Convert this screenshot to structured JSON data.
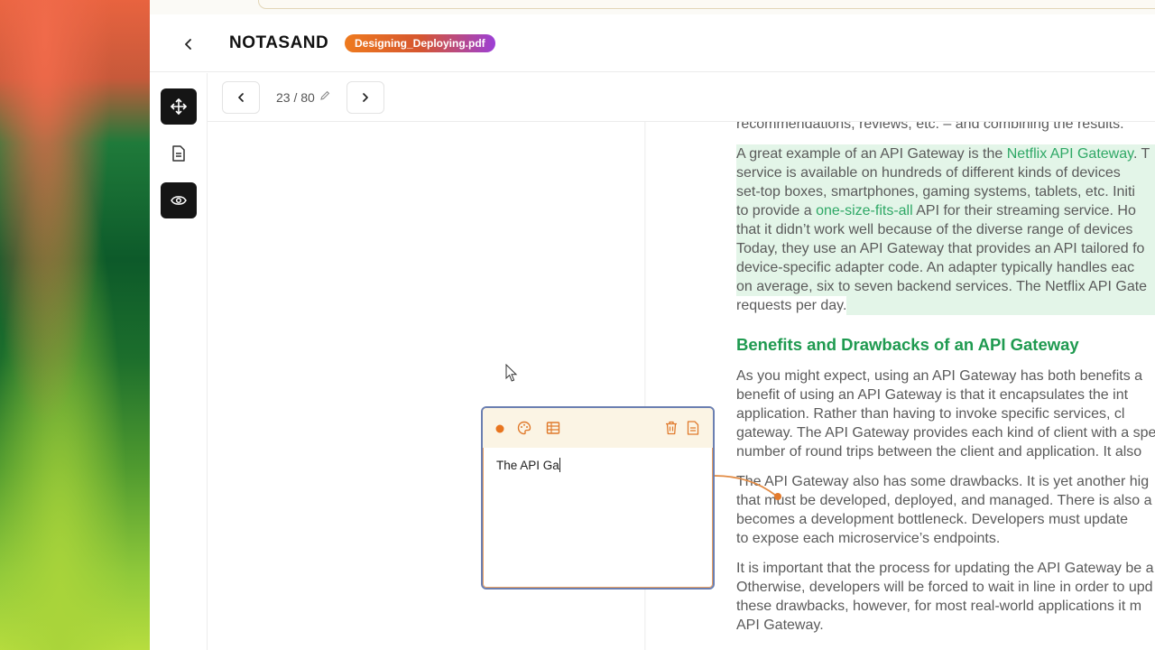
{
  "app": {
    "brand": "NOTASAND",
    "file_name": "Designing_Deploying.pdf"
  },
  "pager": {
    "page_label": "23 / 80"
  },
  "tools": [
    {
      "name": "move-tool",
      "icon": "move-icon",
      "active": true
    },
    {
      "name": "document-tool",
      "icon": "document-icon",
      "active": false
    },
    {
      "name": "view-tool",
      "icon": "eye-icon",
      "active": true
    }
  ],
  "note": {
    "text": "The API Ga",
    "icons": [
      "status-dot-icon",
      "palette-icon",
      "table-icon",
      "trash-icon",
      "note-document-icon"
    ]
  },
  "document": {
    "top_line": "recommendations, reviews, etc. – and combining the results.",
    "para1": {
      "l1a": "A great example of an API Gateway is the ",
      "l1_link": "Netflix API Gateway",
      "l1b": ". T",
      "l2": "service is available on hundreds of different kinds of devices",
      "l3": "set-top boxes, smartphones, gaming systems, tablets, etc. Initi",
      "l4a": "to provide a ",
      "l4_link": "one-size-fits-all",
      "l4b": " API for their streaming service. Ho",
      "l5": "that it didn’t work well because of the diverse range of devices",
      "l6": "Today, they use an API Gateway that provides an API tailored fo",
      "l7": "device-specific adapter code. An adapter typically handles eac",
      "l8": "on average, six to seven backend services. The Netflix API Gate",
      "l9": "requests per day."
    },
    "heading": "Benefits and Drawbacks of an API Gateway",
    "para2": [
      "As you might expect, using an API Gateway has both benefits a",
      "benefit of using an API Gateway is that it encapsulates the int",
      "application. Rather than having to invoke specific services, cl",
      "gateway. The API Gateway provides each kind of client with a spe",
      "number of round trips between the client and application. It also"
    ],
    "para3": [
      "The API Gateway also has some drawbacks. It is yet another hig",
      "that must be developed, deployed, and managed. There is also a",
      "becomes a development bottleneck. Developers must update",
      "to expose each microservice’s endpoints."
    ],
    "para4": [
      "It is important that the process for updating the API Gateway be a",
      "Otherwise, developers will be forced to wait in line in order to upd",
      "these drawbacks, however, for most real-world applications it m",
      "API Gateway."
    ]
  }
}
